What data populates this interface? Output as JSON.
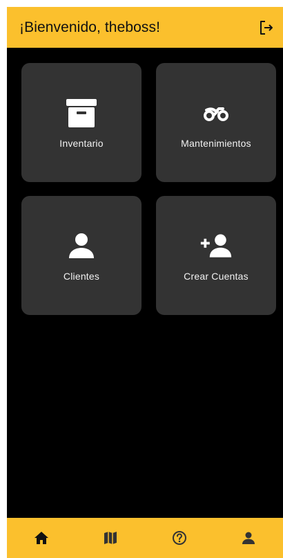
{
  "app_bar": {
    "title": "¡Bienvenido, theboss!",
    "action_icon": "logout-icon"
  },
  "tiles": [
    {
      "label": "Inventario",
      "icon": "archive-box-icon"
    },
    {
      "label": "Mantenimientos",
      "icon": "motorcycle-icon"
    },
    {
      "label": "Clientes",
      "icon": "person-icon"
    },
    {
      "label": "Crear Cuentas",
      "icon": "person-add-icon"
    }
  ],
  "bottom_nav": [
    {
      "icon": "home-icon",
      "active": true
    },
    {
      "icon": "map-icon",
      "active": false
    },
    {
      "icon": "help-icon",
      "active": false
    },
    {
      "icon": "person-icon",
      "active": false
    }
  ],
  "colors": {
    "accent": "#fbc02d",
    "background": "#000000",
    "tile": "#333333"
  }
}
